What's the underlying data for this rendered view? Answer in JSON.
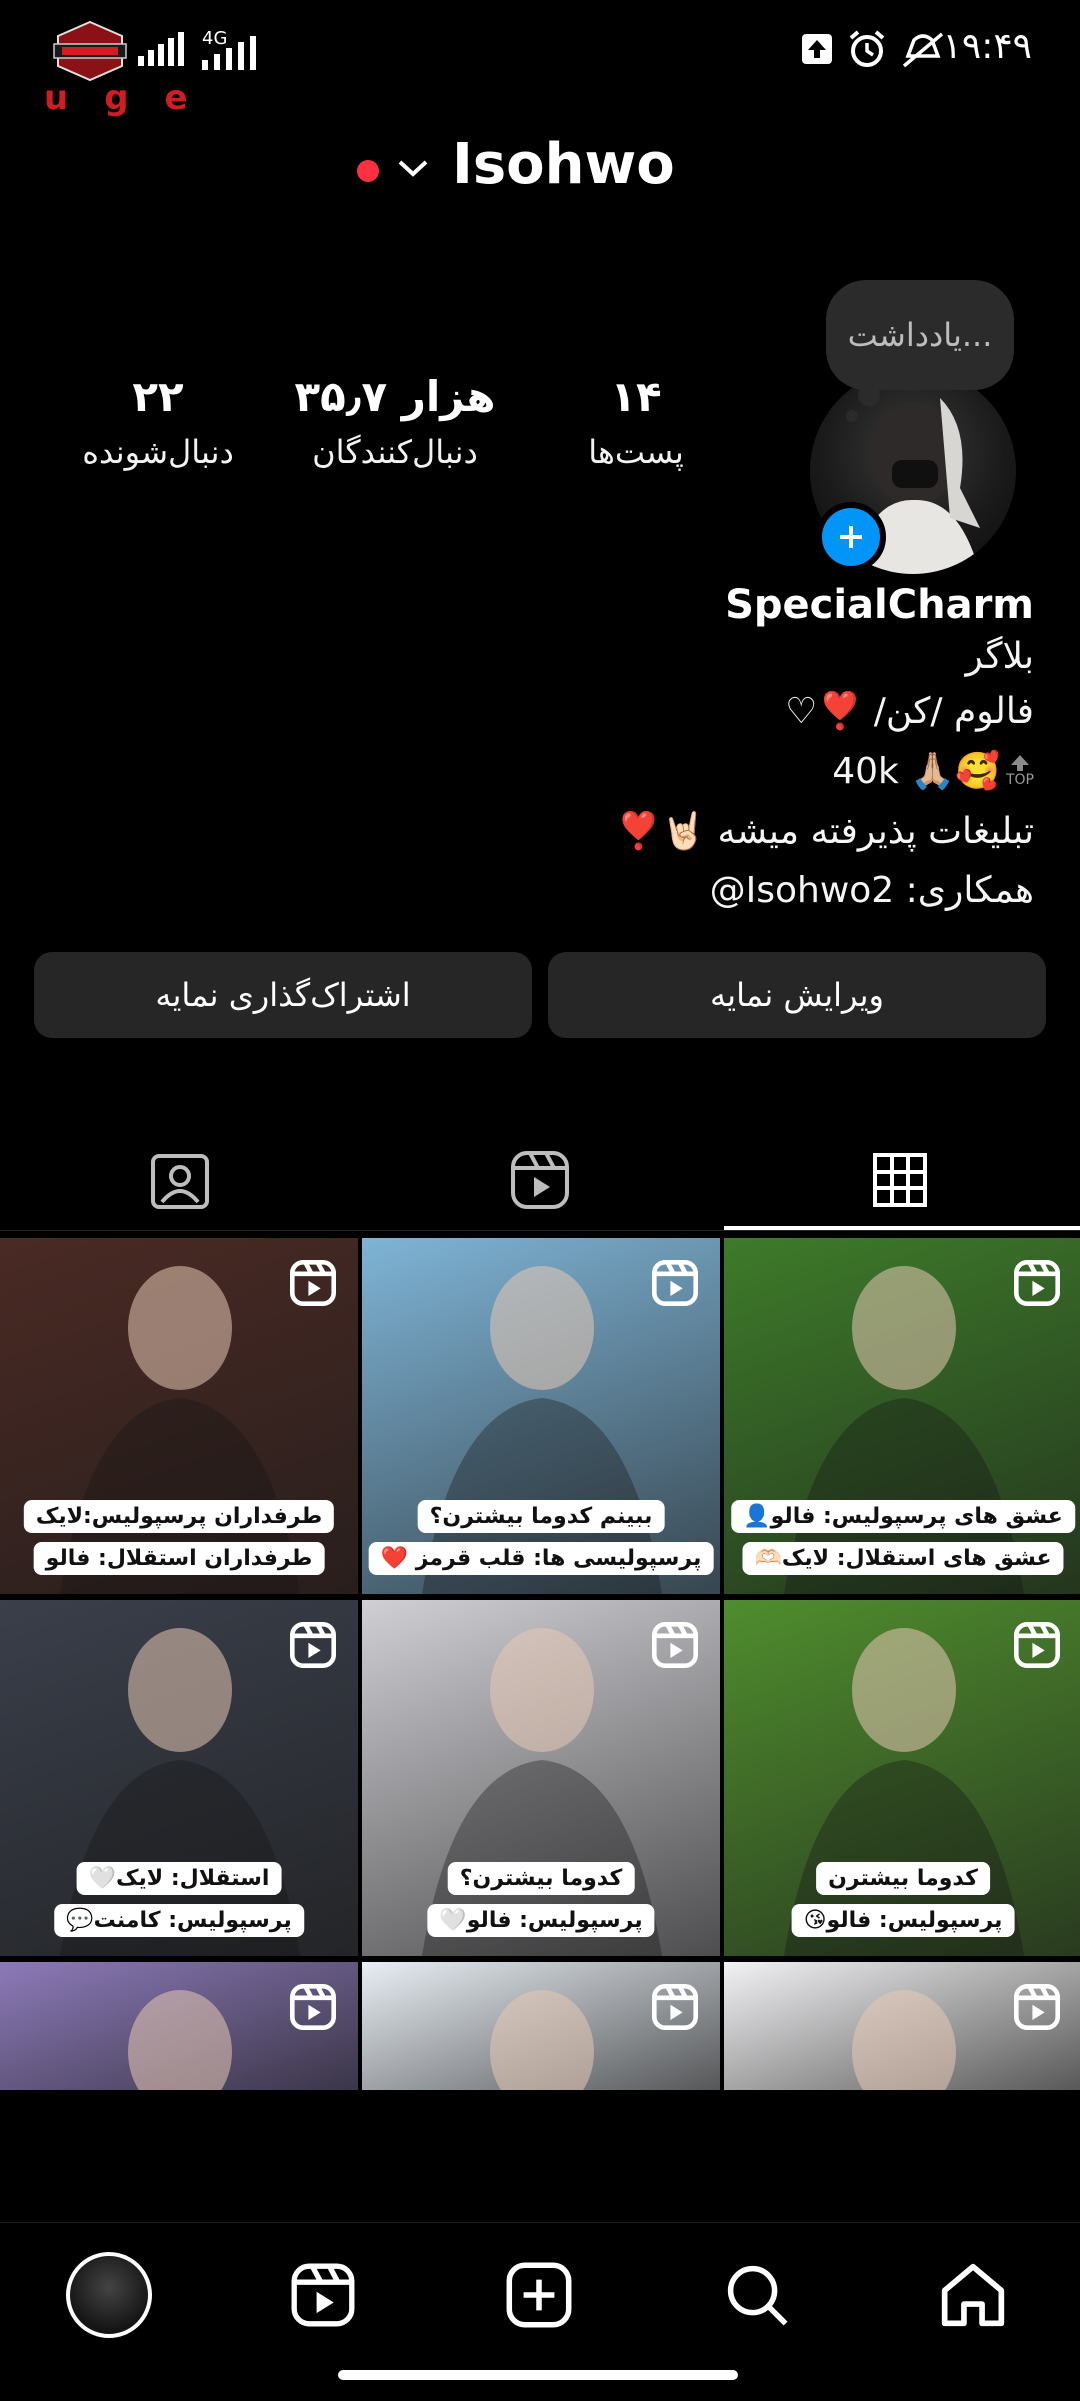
{
  "status_bar": {
    "time": "۱۹:۴۹",
    "network": "4G",
    "carrier_letters": "uge"
  },
  "header": {
    "username": "Isohwo"
  },
  "note": {
    "placeholder": "یادداشت..."
  },
  "stats": {
    "posts": {
      "value": "۱۴",
      "label": "پست‌ها"
    },
    "followers": {
      "value": "۳۵٫۷ هزار",
      "label": "دنبال‌کنندگان"
    },
    "following": {
      "value": "۲۲",
      "label": "دنبال‌شونده"
    }
  },
  "profile": {
    "display_name": "SpecialCharm",
    "category": "بلاگر",
    "bio_line1": "فالوم /کن/ ❣️♡",
    "bio_line2": "40k 🙏🏼🥰",
    "bio_top_badge": "TOP",
    "bio_line3": "تبلیغات پذیرفته میشه 🤘🏻❣️",
    "bio_line4": "همکاری: Isohwo2@"
  },
  "buttons": {
    "edit_profile": "ویرایش نمایه",
    "share_profile": "اشتراک‌گذاری نمایه"
  },
  "tabs": [
    "grid",
    "reels",
    "tagged"
  ],
  "grid": {
    "tiles": [
      {
        "cap1": "عشق های پرسپولیس: فالو👤",
        "cap2": "عشق های استقلال: لایک🫶🏻",
        "bg": "#3e7b2a"
      },
      {
        "cap1": "ببینم کدوما بیشترن؟",
        "cap2": "پرسپولیسی ها: قلب قرمز ❤️",
        "bg": "#7fb4d6"
      },
      {
        "cap1": "طرفداران پرسپولیس:لایک",
        "cap2": "طرفداران استقلال: فالو",
        "bg": "#4a2a24"
      },
      {
        "cap1": "کدوما بیشترن",
        "cap2": "پرسپولیس: فالو😘",
        "bg": "#4f8d2e"
      },
      {
        "cap1": "کدوما بیشترن؟",
        "cap2": "پرسپولیس: فالو🤍",
        "bg": "#cfcfd4"
      },
      {
        "cap1": "استقلال: لایک🤍",
        "cap2": "پرسپولیس: کامنت💬",
        "bg": "#3a3f4a"
      },
      {
        "cap1": "",
        "cap2": "",
        "bg": "#f2f2f4"
      },
      {
        "cap1": "",
        "cap2": "",
        "bg": "#e8eef4"
      },
      {
        "cap1": "",
        "cap2": "",
        "bg": "#8c7ab8"
      }
    ]
  },
  "bottom_nav": [
    "profile-avatar",
    "reels",
    "create",
    "search",
    "home"
  ]
}
